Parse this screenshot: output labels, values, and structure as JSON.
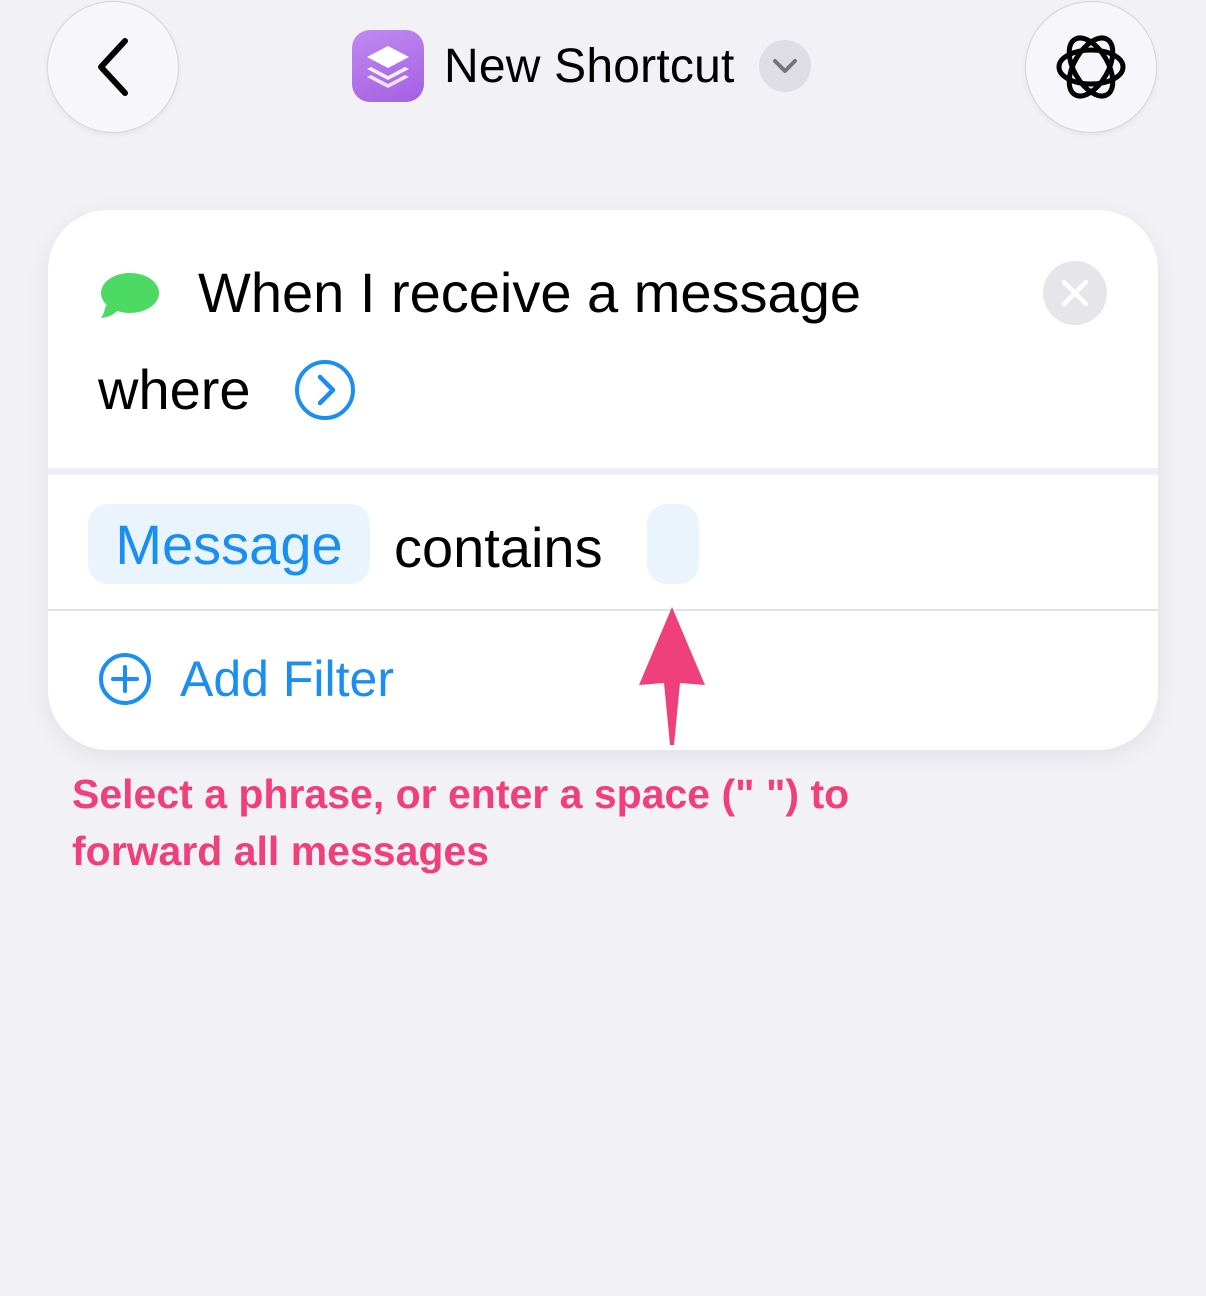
{
  "nav": {
    "back_icon": "chevron-left-icon",
    "title": "New Shortcut",
    "app_icon": "shortcuts-icon",
    "title_menu_icon": "chevron-down-icon",
    "assistant_icon": "apple-intelligence-icon"
  },
  "trigger": {
    "icon": "messages-icon",
    "title": "When I receive a message",
    "where_label": "where",
    "close_icon": "close-icon"
  },
  "filter": {
    "field_label": "Message",
    "operator_label": "contains",
    "value": ""
  },
  "add_filter": {
    "label": "Add Filter",
    "icon": "plus-circle-icon"
  },
  "annotation": {
    "text": "Select a phrase, or enter a space (\" \") to forward all messages",
    "color": "#f0407c",
    "arrow_icon": "arrow-up-icon"
  },
  "colors": {
    "background": "#f2f1f6",
    "card": "#ffffff",
    "accent": "#1a8ff1",
    "messages_green": "#4cd964"
  }
}
